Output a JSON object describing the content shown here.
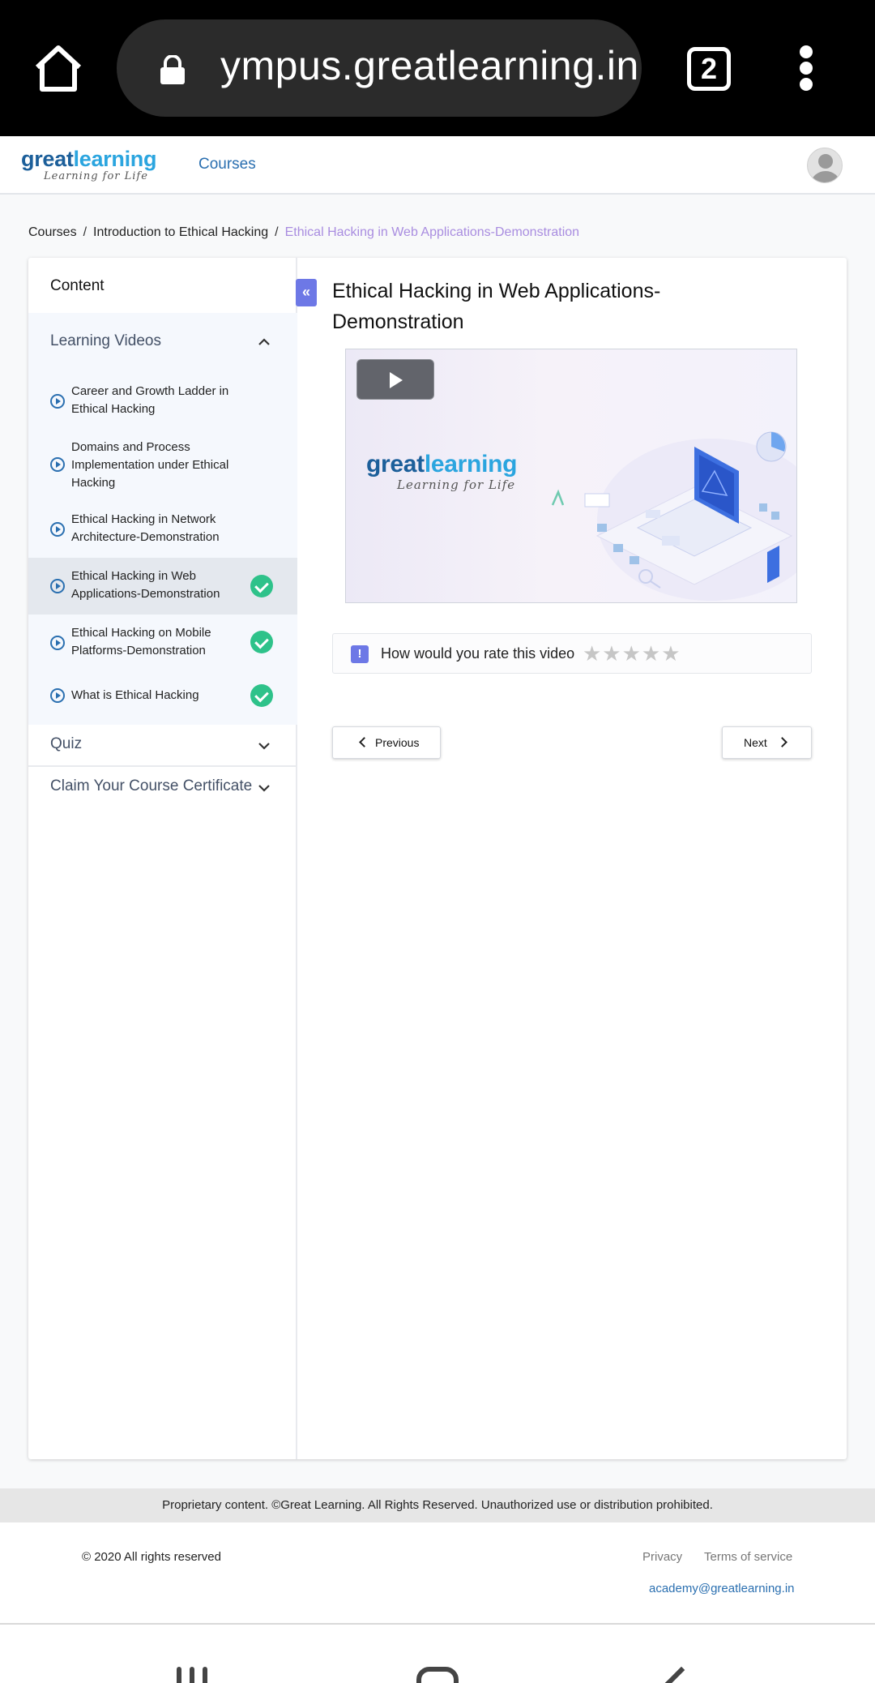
{
  "browser": {
    "url": "ympus.greatlearning.in",
    "tab_count": "2"
  },
  "header": {
    "logo_part1": "great",
    "logo_part2": "learning",
    "logo_tagline": "Learning for Life",
    "nav_courses": "Courses"
  },
  "breadcrumb": {
    "items": [
      "Courses",
      "Introduction to Ethical Hacking"
    ],
    "current": "Ethical Hacking in Web Applications-Demonstration",
    "separator": "/"
  },
  "sidebar": {
    "title": "Content",
    "sections": {
      "learning_videos": "Learning Videos",
      "quiz": "Quiz",
      "certificate": "Claim Your Course Certificate"
    },
    "items": [
      {
        "label": "Career and Growth Ladder in Ethical Hacking",
        "completed": false,
        "active": false
      },
      {
        "label": "Domains and Process Implementation under Ethical Hacking",
        "completed": false,
        "active": false
      },
      {
        "label": "Ethical Hacking in Network Architecture-Demonstration",
        "completed": false,
        "active": false
      },
      {
        "label": "Ethical Hacking in Web Applications-Demonstration",
        "completed": true,
        "active": true
      },
      {
        "label": "Ethical Hacking on Mobile Platforms-Demonstration",
        "completed": true,
        "active": false
      },
      {
        "label": "What is Ethical Hacking",
        "completed": true,
        "active": false
      }
    ]
  },
  "main": {
    "collapse_glyph": "«",
    "title": "Ethical Hacking in Web Applications-Demonstration",
    "video_logo_part1": "great",
    "video_logo_part2": "learning",
    "video_logo_tagline": "Learning for Life",
    "rating_icon_glyph": "!",
    "rating_prompt": "How would you rate this video",
    "rating_stars": "★★★★★",
    "rating_value": 0,
    "rating_max": 5,
    "previous_label": "Previous",
    "next_label": "Next"
  },
  "footer": {
    "notice": "Proprietary content. ©Great Learning. All Rights Reserved. Unauthorized use or distribution prohibited.",
    "copyright": "© 2020 All rights reserved",
    "privacy": "Privacy",
    "terms": "Terms of service",
    "email": "academy@greatlearning.in"
  },
  "colors": {
    "accent": "#6d78e6",
    "link": "#2a6fb0",
    "success": "#2ec28a",
    "breadcrumb_current": "#a98de0"
  }
}
